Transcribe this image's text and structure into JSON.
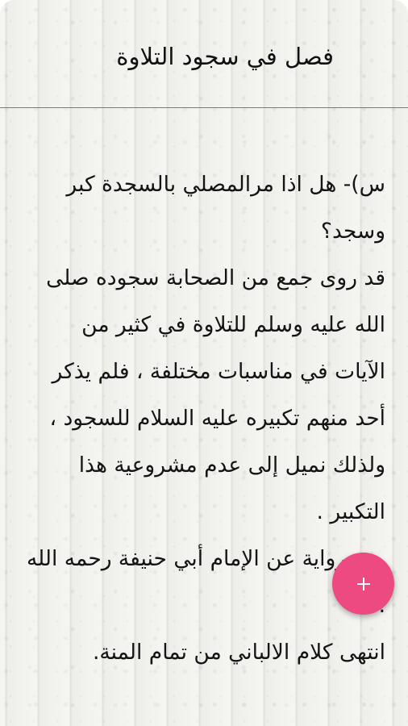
{
  "header": {
    "title": "فصل في سجود التلاوة"
  },
  "article": {
    "paragraphs": [
      "س)- هل اذا مرالمصلي بالسجدة كبر وسجد؟",
      "قد روى جمع من الصحابة سجوده صلى الله عليه وسلم للتلاوة في كثير من الآيات في مناسبات مختلفة ، فلم يذكر أحد منهم تكبيره عليه السلام للسجود ، ولذلك نميل إلى عدم مشروعية هذا التكبير .",
      "وهو رواية عن الإمام أبي حنيفة رحمه الله .",
      "انتهى كلام الالباني من تمام المنة."
    ]
  },
  "fab": {
    "icon": "plus-icon",
    "color": "#ec4a80"
  }
}
